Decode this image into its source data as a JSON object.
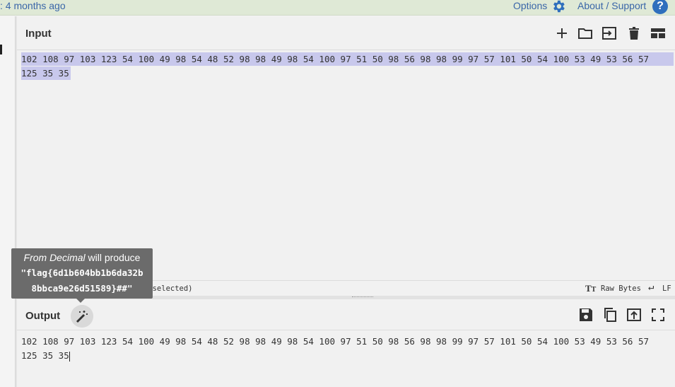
{
  "topbar": {
    "updated_text": ": 4 months ago",
    "options_label": "Options",
    "about_label": "About / Support",
    "help_glyph": "?"
  },
  "input": {
    "title": "Input",
    "line1": "102 108 97 103 123 54 100 49 98 54 48 52 98 98 49 98 54 100 97 51 50 98 56 98 98 99 97 57 101 50 54 100 53 49 53 56 57",
    "line2": "125 35 35",
    "status_selected": "(128 selected)",
    "status_encoding": "Raw Bytes",
    "status_eol": "LF",
    "toolbar_icons": [
      "plus-icon",
      "folder-icon",
      "input-arrow-icon",
      "trash-icon",
      "layout-icon"
    ]
  },
  "output": {
    "title": "Output",
    "line1": "102 108 97 103 123 54 100 49 98 54 48 52 98 98 49 98 54 100 97 51 50 98 56 98 98 99 97 57 101 50 54 100 53 49 53 56 57",
    "line2": "125 35 35",
    "toolbar_icons": [
      "save-icon",
      "copy-icon",
      "replace-input-icon",
      "fullscreen-icon"
    ]
  },
  "tooltip": {
    "op_name": "From Decimal",
    "suffix": " will produce",
    "result_line1": "\"flag{6d1b604bb1b6da32b",
    "result_line2": "8bbca9e26d51589}##\""
  },
  "colors": {
    "banner": "#dfe9d6",
    "link": "#3a66a8",
    "selection": "#c8c8ec",
    "tooltip": "#6b6b6b"
  }
}
